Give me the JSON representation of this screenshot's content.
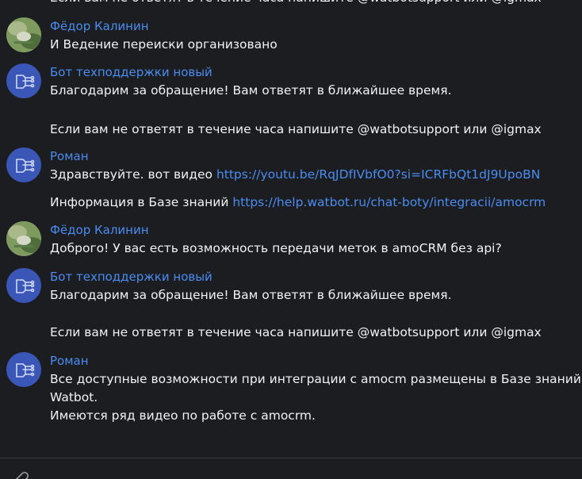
{
  "top_partial": "Если вам не ответят в течение часа напишите @watbotsupport или @igmax",
  "messages": [
    {
      "author": "Фёдор Калинин",
      "avatar_icon": "user-photo-avatar",
      "lines": [
        "И Ведение переиски организовано"
      ]
    },
    {
      "author": "Бот техподдержки новый",
      "avatar_icon": "bot-avatar-icon",
      "lines": [
        "Благодарим за обращение! Вам ответят в ближайшее время.",
        "",
        "Если вам не ответят в течение часа напишите @watbotsupport или @igmax"
      ]
    },
    {
      "author": "Роман",
      "avatar_icon": "bot-avatar-icon",
      "line1_text": "Здравствуйте. вот видео ",
      "line1_link": "https://youtu.be/RqJDfIVbfO0?si=ICRFbQt1dJ9UpoBN",
      "line2_text": "Информация в Базе знаний ",
      "line2_link": "https://help.watbot.ru/chat-boty/integracii/amocrm"
    },
    {
      "author": "Фёдор Калинин",
      "avatar_icon": "user-photo-avatar",
      "lines": [
        "Доброго! У вас есть возможность передачи меток в amoCRM без api?"
      ]
    },
    {
      "author": "Бот техподдержки новый",
      "avatar_icon": "bot-avatar-icon",
      "lines": [
        "Благодарим за обращение! Вам ответят в ближайшее время.",
        "",
        "Если вам не ответят в течение часа напишите @watbotsupport или @igmax"
      ]
    },
    {
      "author": "Роман",
      "avatar_icon": "bot-avatar-icon",
      "lines": [
        "Все доступные возможности при интеграции с amocm размещены в Базе знаний",
        "Watbot.",
        "Имеются ряд видео по работе с amocrm."
      ]
    }
  ],
  "composer": {
    "attach_icon": "paperclip-icon",
    "emoji_icon": "emoji-icon"
  },
  "colors": {
    "background": "#1c1d21",
    "author": "#4a8cf0",
    "link": "#4a8cf0",
    "text": "#f2f2f2",
    "bot_avatar": "#3a57b8"
  }
}
